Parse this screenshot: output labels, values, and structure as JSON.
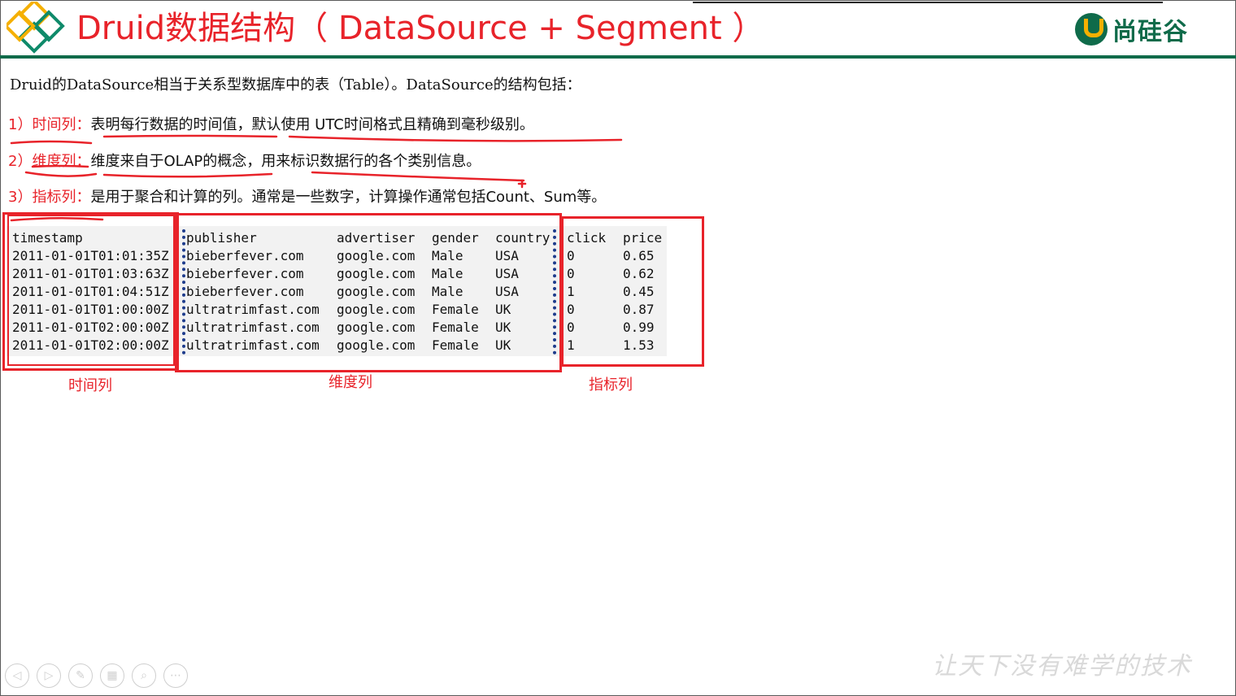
{
  "header": {
    "title": "Druid数据结构（  DataSource + Segment  ）",
    "brand_name": "尚硅谷",
    "accent_color": "#e8232a",
    "brand_color": "#0f6b4a"
  },
  "content": {
    "intro": "Druid的DataSource相当于关系型数据库中的表（Table）。DataSource的结构包括：",
    "items": [
      {
        "label": "1）时间列：",
        "text": "表明每行数据的时间值，默认使用 UTC时间格式且精确到毫秒级别。"
      },
      {
        "label": "2）维度列：",
        "text": "维度来自于OLAP的概念，用来标识数据行的各个类别信息。"
      },
      {
        "label": "3）指标列：",
        "text": "是用于聚合和计算的列。通常是一些数字，计算操作通常包括Count、Sum等。"
      }
    ]
  },
  "table": {
    "headers": [
      "timestamp",
      "publisher",
      "advertiser",
      "gender",
      "country",
      "click",
      "price"
    ],
    "rows": [
      [
        "2011-01-01T01:01:35Z",
        "bieberfever.com",
        "google.com",
        "Male",
        "USA",
        "0",
        "0.65"
      ],
      [
        "2011-01-01T01:03:63Z",
        "bieberfever.com",
        "google.com",
        "Male",
        "USA",
        "0",
        "0.62"
      ],
      [
        "2011-01-01T01:04:51Z",
        "bieberfever.com",
        "google.com",
        "Male",
        "USA",
        "1",
        "0.45"
      ],
      [
        "2011-01-01T01:00:00Z",
        "ultratrimfast.com",
        "google.com",
        "Female",
        "UK",
        "0",
        "0.87"
      ],
      [
        "2011-01-01T02:00:00Z",
        "ultratrimfast.com",
        "google.com",
        "Female",
        "UK",
        "0",
        "0.99"
      ],
      [
        "2011-01-01T02:00:00Z",
        "ultratrimfast.com",
        "google.com",
        "Female",
        "UK",
        "1",
        "1.53"
      ]
    ]
  },
  "captions": {
    "time": "时间列",
    "dimension": "维度列",
    "metric": "指标列"
  },
  "footer": {
    "slogan": "让天下没有难学的技术",
    "controls": [
      {
        "icon": "prev-icon",
        "glyph": "◁"
      },
      {
        "icon": "next-icon",
        "glyph": "▷"
      },
      {
        "icon": "pen-icon",
        "glyph": "✎"
      },
      {
        "icon": "slides-icon",
        "glyph": "▦"
      },
      {
        "icon": "zoom-icon",
        "glyph": "⌕"
      },
      {
        "icon": "more-icon",
        "glyph": "⋯"
      }
    ]
  }
}
